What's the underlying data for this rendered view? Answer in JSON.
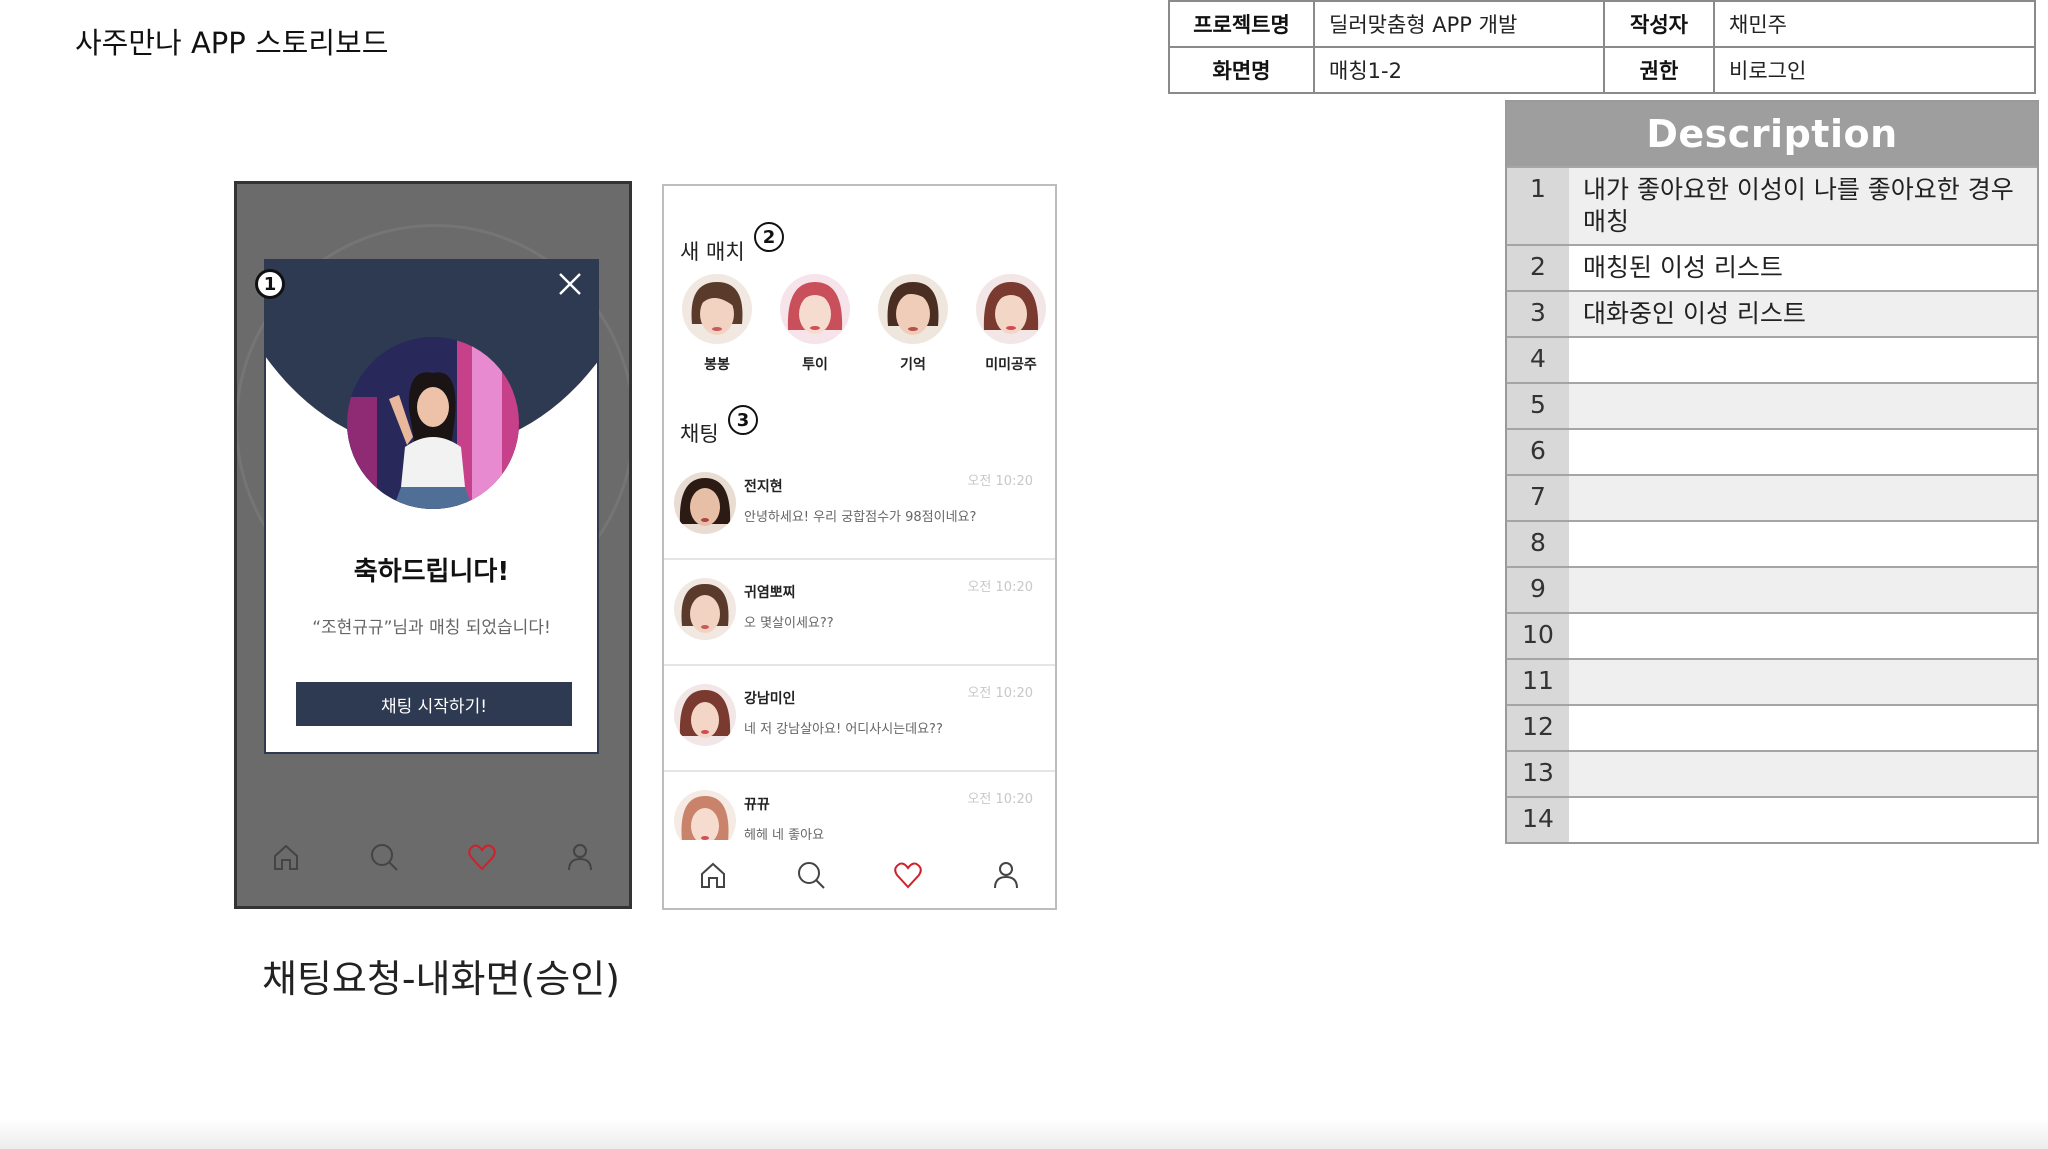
{
  "document": {
    "title": "사주만나 APP 스토리보드",
    "screen_caption": "채팅요청-내화면(승인)"
  },
  "meta": {
    "project_label": "프로젝트명",
    "project_value": "딜러맞춤형 APP 개발",
    "author_label": "작성자",
    "author_value": "채민주",
    "screen_label": "화면명",
    "screen_value": "매칭1-2",
    "permission_label": "권한",
    "permission_value": "비로그인"
  },
  "description": {
    "header": "Description",
    "rows": [
      {
        "num": "1",
        "text": "내가 좋아요한 이성이 나를 좋아요한 경우 매칭"
      },
      {
        "num": "2",
        "text": "매칭된 이성 리스트"
      },
      {
        "num": "3",
        "text": "대화중인 이성 리스트"
      },
      {
        "num": "4",
        "text": ""
      },
      {
        "num": "5",
        "text": ""
      },
      {
        "num": "6",
        "text": ""
      },
      {
        "num": "7",
        "text": ""
      },
      {
        "num": "8",
        "text": ""
      },
      {
        "num": "9",
        "text": ""
      },
      {
        "num": "10",
        "text": ""
      },
      {
        "num": "11",
        "text": ""
      },
      {
        "num": "12",
        "text": ""
      },
      {
        "num": "13",
        "text": ""
      },
      {
        "num": "14",
        "text": ""
      }
    ]
  },
  "phone1": {
    "badge": "1",
    "modal": {
      "title": "축하드립니다!",
      "message": "“조현규규”님과 매칭 되었습니다!",
      "button_label": "채팅 시작하기!"
    }
  },
  "phone2": {
    "badge_matches": "2",
    "badge_chats": "3",
    "new_match_label": "새 매치",
    "chat_label": "채팅",
    "matches": [
      {
        "name": "봉봉"
      },
      {
        "name": "투이"
      },
      {
        "name": "기억"
      },
      {
        "name": "미미공주"
      }
    ],
    "chats": [
      {
        "name": "전지현",
        "message": "안녕하세요! 우리 궁합점수가 98점이네요?",
        "time": "오전 10:20"
      },
      {
        "name": "귀염뽀찌",
        "message": "오 몇살이세요??",
        "time": "오전 10:20"
      },
      {
        "name": "강남미인",
        "message": "네 저 강남살아요! 어디사시는데요??",
        "time": "오전 10:20"
      },
      {
        "name": "뀨뀨",
        "message": "헤헤 네 좋아요",
        "time": "오전 10:20"
      }
    ]
  },
  "colors": {
    "accent_navy": "#2e3a52",
    "heart_red": "#d0202a",
    "overlay_gray": "#6b6b6b"
  },
  "icons": {
    "tabbar": [
      "home-icon",
      "search-icon",
      "heart-icon",
      "profile-icon"
    ],
    "modal_close": "close-icon"
  }
}
